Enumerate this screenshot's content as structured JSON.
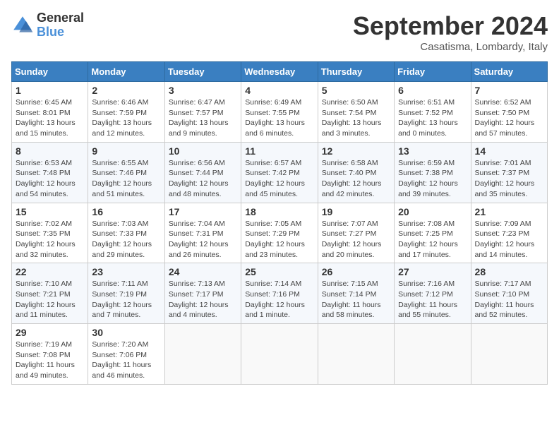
{
  "logo": {
    "general": "General",
    "blue": "Blue"
  },
  "title": "September 2024",
  "subtitle": "Casatisma, Lombardy, Italy",
  "days_header": [
    "Sunday",
    "Monday",
    "Tuesday",
    "Wednesday",
    "Thursday",
    "Friday",
    "Saturday"
  ],
  "weeks": [
    [
      {
        "day": "1",
        "sunrise": "Sunrise: 6:45 AM",
        "sunset": "Sunset: 8:01 PM",
        "daylight": "Daylight: 13 hours and 15 minutes."
      },
      {
        "day": "2",
        "sunrise": "Sunrise: 6:46 AM",
        "sunset": "Sunset: 7:59 PM",
        "daylight": "Daylight: 13 hours and 12 minutes."
      },
      {
        "day": "3",
        "sunrise": "Sunrise: 6:47 AM",
        "sunset": "Sunset: 7:57 PM",
        "daylight": "Daylight: 13 hours and 9 minutes."
      },
      {
        "day": "4",
        "sunrise": "Sunrise: 6:49 AM",
        "sunset": "Sunset: 7:55 PM",
        "daylight": "Daylight: 13 hours and 6 minutes."
      },
      {
        "day": "5",
        "sunrise": "Sunrise: 6:50 AM",
        "sunset": "Sunset: 7:54 PM",
        "daylight": "Daylight: 13 hours and 3 minutes."
      },
      {
        "day": "6",
        "sunrise": "Sunrise: 6:51 AM",
        "sunset": "Sunset: 7:52 PM",
        "daylight": "Daylight: 13 hours and 0 minutes."
      },
      {
        "day": "7",
        "sunrise": "Sunrise: 6:52 AM",
        "sunset": "Sunset: 7:50 PM",
        "daylight": "Daylight: 12 hours and 57 minutes."
      }
    ],
    [
      {
        "day": "8",
        "sunrise": "Sunrise: 6:53 AM",
        "sunset": "Sunset: 7:48 PM",
        "daylight": "Daylight: 12 hours and 54 minutes."
      },
      {
        "day": "9",
        "sunrise": "Sunrise: 6:55 AM",
        "sunset": "Sunset: 7:46 PM",
        "daylight": "Daylight: 12 hours and 51 minutes."
      },
      {
        "day": "10",
        "sunrise": "Sunrise: 6:56 AM",
        "sunset": "Sunset: 7:44 PM",
        "daylight": "Daylight: 12 hours and 48 minutes."
      },
      {
        "day": "11",
        "sunrise": "Sunrise: 6:57 AM",
        "sunset": "Sunset: 7:42 PM",
        "daylight": "Daylight: 12 hours and 45 minutes."
      },
      {
        "day": "12",
        "sunrise": "Sunrise: 6:58 AM",
        "sunset": "Sunset: 7:40 PM",
        "daylight": "Daylight: 12 hours and 42 minutes."
      },
      {
        "day": "13",
        "sunrise": "Sunrise: 6:59 AM",
        "sunset": "Sunset: 7:38 PM",
        "daylight": "Daylight: 12 hours and 39 minutes."
      },
      {
        "day": "14",
        "sunrise": "Sunrise: 7:01 AM",
        "sunset": "Sunset: 7:37 PM",
        "daylight": "Daylight: 12 hours and 35 minutes."
      }
    ],
    [
      {
        "day": "15",
        "sunrise": "Sunrise: 7:02 AM",
        "sunset": "Sunset: 7:35 PM",
        "daylight": "Daylight: 12 hours and 32 minutes."
      },
      {
        "day": "16",
        "sunrise": "Sunrise: 7:03 AM",
        "sunset": "Sunset: 7:33 PM",
        "daylight": "Daylight: 12 hours and 29 minutes."
      },
      {
        "day": "17",
        "sunrise": "Sunrise: 7:04 AM",
        "sunset": "Sunset: 7:31 PM",
        "daylight": "Daylight: 12 hours and 26 minutes."
      },
      {
        "day": "18",
        "sunrise": "Sunrise: 7:05 AM",
        "sunset": "Sunset: 7:29 PM",
        "daylight": "Daylight: 12 hours and 23 minutes."
      },
      {
        "day": "19",
        "sunrise": "Sunrise: 7:07 AM",
        "sunset": "Sunset: 7:27 PM",
        "daylight": "Daylight: 12 hours and 20 minutes."
      },
      {
        "day": "20",
        "sunrise": "Sunrise: 7:08 AM",
        "sunset": "Sunset: 7:25 PM",
        "daylight": "Daylight: 12 hours and 17 minutes."
      },
      {
        "day": "21",
        "sunrise": "Sunrise: 7:09 AM",
        "sunset": "Sunset: 7:23 PM",
        "daylight": "Daylight: 12 hours and 14 minutes."
      }
    ],
    [
      {
        "day": "22",
        "sunrise": "Sunrise: 7:10 AM",
        "sunset": "Sunset: 7:21 PM",
        "daylight": "Daylight: 12 hours and 11 minutes."
      },
      {
        "day": "23",
        "sunrise": "Sunrise: 7:11 AM",
        "sunset": "Sunset: 7:19 PM",
        "daylight": "Daylight: 12 hours and 7 minutes."
      },
      {
        "day": "24",
        "sunrise": "Sunrise: 7:13 AM",
        "sunset": "Sunset: 7:17 PM",
        "daylight": "Daylight: 12 hours and 4 minutes."
      },
      {
        "day": "25",
        "sunrise": "Sunrise: 7:14 AM",
        "sunset": "Sunset: 7:16 PM",
        "daylight": "Daylight: 12 hours and 1 minute."
      },
      {
        "day": "26",
        "sunrise": "Sunrise: 7:15 AM",
        "sunset": "Sunset: 7:14 PM",
        "daylight": "Daylight: 11 hours and 58 minutes."
      },
      {
        "day": "27",
        "sunrise": "Sunrise: 7:16 AM",
        "sunset": "Sunset: 7:12 PM",
        "daylight": "Daylight: 11 hours and 55 minutes."
      },
      {
        "day": "28",
        "sunrise": "Sunrise: 7:17 AM",
        "sunset": "Sunset: 7:10 PM",
        "daylight": "Daylight: 11 hours and 52 minutes."
      }
    ],
    [
      {
        "day": "29",
        "sunrise": "Sunrise: 7:19 AM",
        "sunset": "Sunset: 7:08 PM",
        "daylight": "Daylight: 11 hours and 49 minutes."
      },
      {
        "day": "30",
        "sunrise": "Sunrise: 7:20 AM",
        "sunset": "Sunset: 7:06 PM",
        "daylight": "Daylight: 11 hours and 46 minutes."
      },
      null,
      null,
      null,
      null,
      null
    ]
  ]
}
